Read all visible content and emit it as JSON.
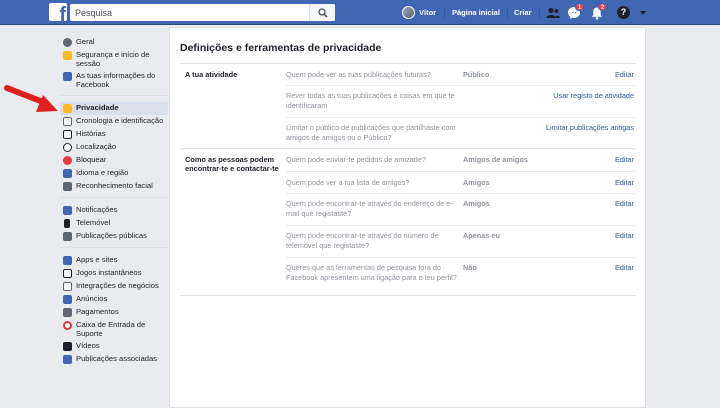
{
  "topbar": {
    "search_placeholder": "Pesquisa",
    "user_name": "Vítor",
    "home": "Página inicial",
    "create": "Criar",
    "messages_badge": "1",
    "notifications_badge": "2",
    "brand_color": "#4267b2"
  },
  "sidebar": {
    "groups": [
      [
        "Geral",
        "Segurança e início de sessão",
        "As tuas informações do Facebook"
      ],
      [
        "Privacidade",
        "Cronologia e identificação",
        "Histórias",
        "Localização",
        "Bloquear",
        "Idioma e região",
        "Reconhecimento facial"
      ],
      [
        "Notificações",
        "Telemóvel",
        "Publicações públicas"
      ],
      [
        "Apps e sites",
        "Jogos instantâneos",
        "Integrações de negócios",
        "Anúncios",
        "Pagamentos",
        "Caixa de Entrada de Suporte",
        "Vídeos",
        "Publicações associadas"
      ]
    ],
    "selected": "Privacidade"
  },
  "main": {
    "title": "Definições e ferramentas de privacidade",
    "sections": [
      {
        "title": "A tua atividade",
        "rows": [
          {
            "question": "Quem pode ver as tuas publicações futuras?",
            "value": "Público",
            "action": "Editar"
          },
          {
            "question": "Rever todas as tuas publicações e coisas em que te identificaram",
            "value": "",
            "action": "Usar registo de atividade"
          },
          {
            "question": "Limitar o público de publicações que partilhaste com amigos de amigos ou o Público?",
            "value": "",
            "action": "Limitar publicações antigas"
          }
        ]
      },
      {
        "title": "Como as pessoas podem encontrar-te e contactar-te",
        "rows": [
          {
            "question": "Quem pode enviar-te pedidos de amizade?",
            "value": "Amigos de amigos",
            "action": "Editar"
          },
          {
            "question": "Quem pode ver a tua lista de amigos?",
            "value": "Amigos",
            "action": "Editar"
          },
          {
            "question": "Quem pode encontrar-te através do endereço de e-mail que registaste?",
            "value": "Amigos",
            "action": "Editar"
          },
          {
            "question": "Quem pode encontrar-te através do número de telemóvel que registaste?",
            "value": "Apenas eu",
            "action": "Editar"
          },
          {
            "question": "Queres que as ferramentas de pesquisa fora do Facebook apresentem uma ligação para o teu perfil?",
            "value": "Não",
            "action": "Editar"
          }
        ]
      }
    ]
  }
}
